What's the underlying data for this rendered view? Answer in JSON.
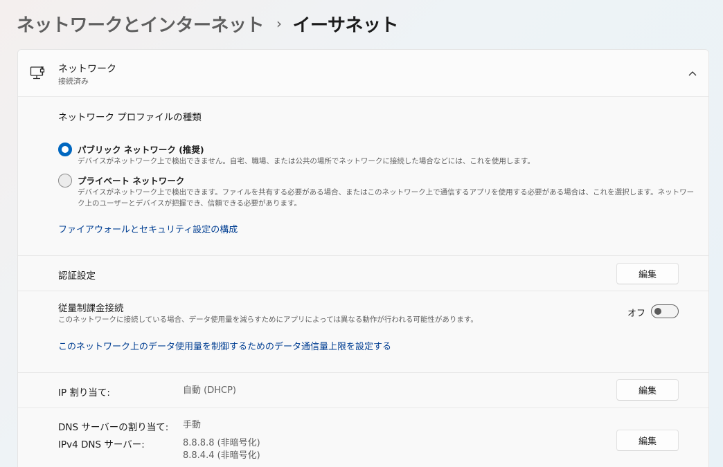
{
  "breadcrumb": {
    "parent": "ネットワークとインターネット",
    "separator": "›",
    "current": "イーサネット"
  },
  "network": {
    "title": "ネットワーク",
    "status": "接続済み",
    "icon": "network-computer-icon",
    "expanded": true
  },
  "profile": {
    "title": "ネットワーク プロファイルの種類",
    "options": [
      {
        "label": "パブリック ネットワーク (推奨)",
        "description": "デバイスがネットワーク上で検出できません。自宅、職場、または公共の場所でネットワークに接続した場合などには、これを使用します。",
        "selected": true
      },
      {
        "label": "プライベート ネットワーク",
        "description": "デバイスがネットワーク上で検出できます。ファイルを共有する必要がある場合、またはこのネットワーク上で通信するアプリを使用する必要がある場合は、これを選択します。ネットワーク上のユーザーとデバイスが把握でき、信頼できる必要があります。",
        "selected": false
      }
    ],
    "firewall_link": "ファイアウォールとセキュリティ設定の構成"
  },
  "auth": {
    "label": "認証設定",
    "button": "編集"
  },
  "metered": {
    "label": "従量制課金接続",
    "description": "このネットワークに接続している場合、データ使用量を減らすためにアプリによっては異なる動作が行われる可能性があります。",
    "state_label": "オフ",
    "on": false,
    "data_limit_link": "このネットワーク上のデータ使用量を制御するためのデータ通信量上限を設定する"
  },
  "ip": {
    "label": "IP 割り当て:",
    "value": "自動 (DHCP)",
    "button": "編集"
  },
  "dns": {
    "assign_label": "DNS サーバーの割り当て:",
    "assign_value": "手動",
    "ipv4_label": "IPv4 DNS サーバー:",
    "servers": [
      "8.8.8.8 (非暗号化)",
      "8.8.4.4 (非暗号化)"
    ],
    "button": "編集"
  },
  "colors": {
    "accent": "#0067c0",
    "link": "#003e92"
  }
}
